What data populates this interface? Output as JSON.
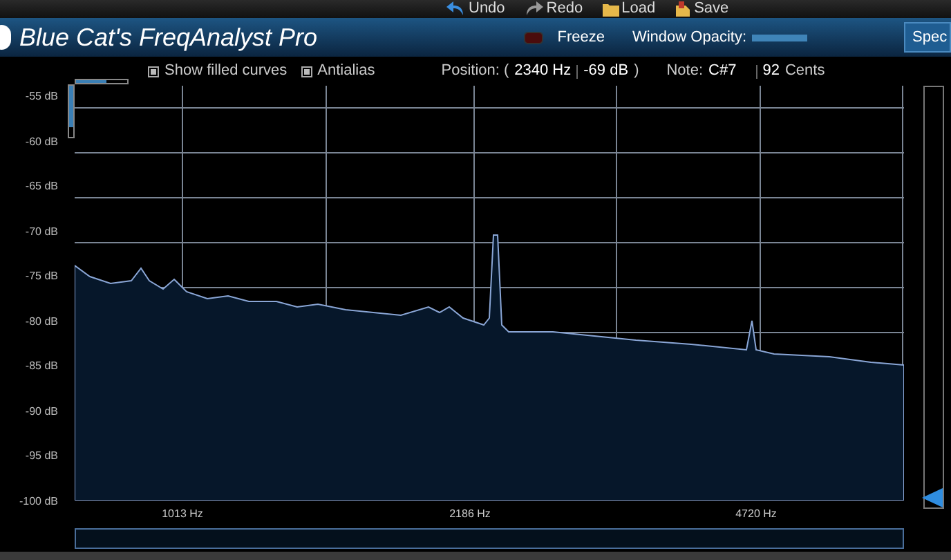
{
  "toolbar": [
    "Undo",
    "Redo",
    "Load",
    "Save"
  ],
  "window": {
    "title": "Blue Cat's FreqAnalyst Pro"
  },
  "freeze": {
    "label": "Freeze",
    "on": false
  },
  "opacity": {
    "label": "Window Opacity:",
    "level": 1
  },
  "spec_button": "Spec",
  "options": [
    {
      "label": "Show filled curves",
      "checked": true
    },
    {
      "label": "Antialias",
      "checked": true
    }
  ],
  "readout": {
    "position_label": "Position: (",
    "frequency": "2340 Hz",
    "level_db": "-69 dB",
    "close": ")",
    "note_label": "Note:",
    "note": "C#7",
    "cents": "92",
    "cents_label": "Cents"
  },
  "h_meter": {
    "level": 0.6
  },
  "v_meter": {
    "level": 0.8
  },
  "y_labels": [
    "-55 dB",
    "-60 dB",
    "-65 dB",
    "-70 dB",
    "-75 dB",
    "-80 dB",
    "-85 dB",
    "-90 dB",
    "-95 dB",
    "-100 dB"
  ],
  "x_labels": [
    "1013 Hz",
    "2186 Hz",
    "4720 Hz"
  ],
  "range_slider": {
    "level": 0
  }
}
